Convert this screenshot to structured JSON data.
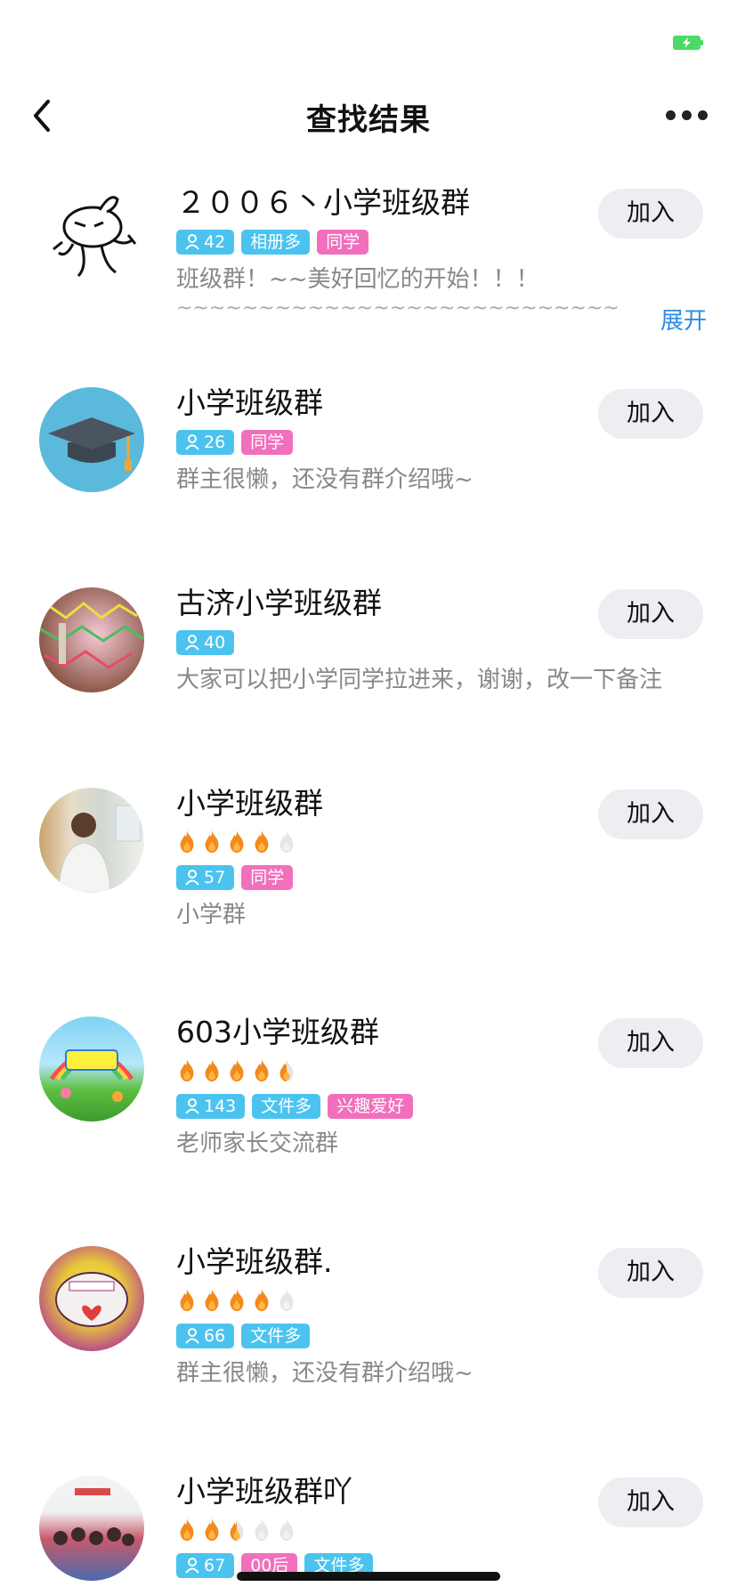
{
  "header": {
    "title": "查找结果"
  },
  "colors": {
    "tag_blue": "#4cc3ef",
    "tag_pink": "#f26fbd",
    "link_blue": "#2f8be3",
    "flame": "#f28a1e"
  },
  "icons": {
    "back": "chevron-left-icon",
    "more": "more-dots-icon",
    "battery": "battery-charging-icon",
    "member": "person-icon",
    "activity": "flame-icon"
  },
  "groups": [
    {
      "name": "２００６丶小学班级群",
      "flames": null,
      "tags": [
        {
          "text": "42",
          "color": "blue",
          "member": true
        },
        {
          "text": "相册多",
          "color": "blue",
          "member": false
        },
        {
          "text": "同学",
          "color": "pink",
          "member": false
        }
      ],
      "description": "班级群！~~美好回忆的开始！！！",
      "description_extra": "~~~~~~~~~~~~~~~~~~~~~~~~~~~~~~~~~~~~~~~",
      "expand_label": "展开",
      "join_label": "加入",
      "avatar": "cartoon-rabbit"
    },
    {
      "name": "小学班级群",
      "flames": null,
      "tags": [
        {
          "text": "26",
          "color": "blue",
          "member": true
        },
        {
          "text": "同学",
          "color": "pink",
          "member": false
        }
      ],
      "description": "群主很懒，还没有群介绍哦~",
      "join_label": "加入",
      "avatar": "graduation-cap"
    },
    {
      "name": "古济小学班级群",
      "flames": null,
      "tags": [
        {
          "text": "40",
          "color": "blue",
          "member": true
        }
      ],
      "description": "大家可以把小学同学拉进来，谢谢，改一下备注",
      "join_label": "加入",
      "avatar": "classroom-flags-photo"
    },
    {
      "name": "小学班级群",
      "flames": 4,
      "tags": [
        {
          "text": "57",
          "color": "blue",
          "member": true
        },
        {
          "text": "同学",
          "color": "pink",
          "member": false
        }
      ],
      "description": "小学群",
      "join_label": "加入",
      "avatar": "man-photo"
    },
    {
      "name": "603小学班级群",
      "flames": 4.5,
      "tags": [
        {
          "text": "143",
          "color": "blue",
          "member": true
        },
        {
          "text": "文件多",
          "color": "blue",
          "member": false
        },
        {
          "text": "兴趣爱好",
          "color": "pink",
          "member": false
        }
      ],
      "description": "老师家长交流群",
      "join_label": "加入",
      "avatar": "school-start-banner"
    },
    {
      "name": "小学班级群.",
      "flames": 4,
      "tags": [
        {
          "text": "66",
          "color": "blue",
          "member": true
        },
        {
          "text": "文件多",
          "color": "blue",
          "member": false
        }
      ],
      "description": "群主很懒，还没有群介绍哦~",
      "join_label": "加入",
      "avatar": "cartoon-sponge-face"
    },
    {
      "name": "小学班级群吖",
      "flames": 2.5,
      "tags": [
        {
          "text": "67",
          "color": "blue",
          "member": true
        },
        {
          "text": "00后",
          "color": "pink",
          "member": false
        },
        {
          "text": "文件多",
          "color": "blue",
          "member": false
        }
      ],
      "description": "",
      "join_label": "加入",
      "avatar": "class-group-photo"
    }
  ]
}
